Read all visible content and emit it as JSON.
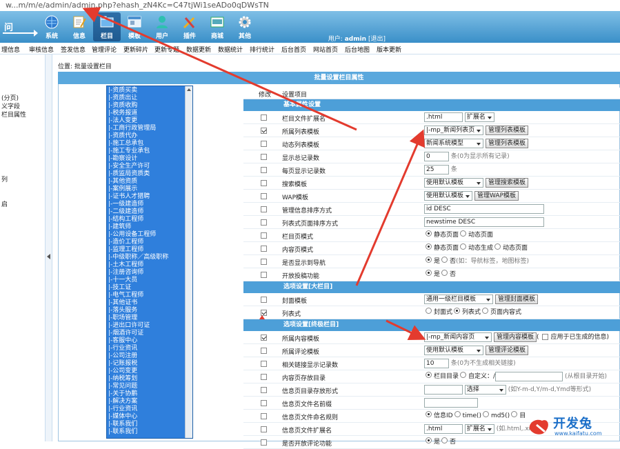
{
  "url": "w...m/m/e/admin/admin.php?ehash_zN4Kc=C47tjWi1seADo0qDWsTN",
  "header": {
    "logo": "问",
    "nav": [
      {
        "label": "系统",
        "icon": "globe-icon"
      },
      {
        "label": "信息",
        "icon": "edit-icon"
      },
      {
        "label": "栏目",
        "icon": "folder-icon",
        "active": true
      },
      {
        "label": "模板",
        "icon": "window-icon"
      },
      {
        "label": "用户",
        "icon": "user-icon"
      },
      {
        "label": "插件",
        "icon": "tools-icon"
      },
      {
        "label": "商城",
        "icon": "shop-icon"
      },
      {
        "label": "其他",
        "icon": "gear-icon"
      }
    ],
    "user_label": "用户:",
    "user_name": "admin",
    "logout": "[退出]"
  },
  "menubar": [
    "理信息",
    "审核信息",
    "签发信息",
    "管理评论",
    "更新碎片",
    "更新专题",
    "数据更新",
    "数据统计",
    "排行统计",
    "后台首页",
    "网站首页",
    "后台地图",
    "版本更新"
  ],
  "sidebar": [
    "(分页)",
    "义字段",
    "栏目属性",
    "列",
    "启"
  ],
  "breadcrumb": {
    "prefix": "位置:",
    "link": "批量设置栏目"
  },
  "panel_title": "批量设置栏目属性",
  "tree": [
    "|-资质买卖",
    "|-资质出让",
    "|-资质收购",
    "|-税务报道",
    "|-法人变更",
    "|-工商行政管理局",
    "|-资质代办",
    "|-施工总承包",
    "|-施工专业承包",
    "|-勘察设计",
    "|-安全生产许可",
    "|-质监局资质类",
    "|-其他资质",
    "|-案例展示",
    "|-证书人才猎聘",
    "|-一级建造师",
    "|-二级建造师",
    "|-结构工程师",
    "|-建筑师",
    "|-公用设备工程师",
    "|-造价工程师",
    "|-监理工程师",
    "|-中级职称／高级职称",
    "|-土木工程师",
    "|-注册咨询师",
    "|-十一大员",
    "|-技工证",
    "|-电气工程师",
    "|-其他证书",
    "|-落头服务",
    "|-职场管理",
    "|-进出口许可证",
    "|-烟酒许可证",
    "|-客服中心",
    "|-行业资讯",
    "|-公司注册",
    "|-记账报税",
    "|-公司变更",
    "|-纳税筹划",
    "|-常见问题",
    "|-关于协鹏",
    "|-解决方案",
    "|-行业资讯",
    "|-媒体中心",
    "|-联系我们",
    "|-联系我们"
  ],
  "table_head": {
    "modify": "修改",
    "item": "设置项目"
  },
  "sections": {
    "basic": "基本属性设置",
    "major": "选项设置[大栏目]",
    "final": "选项设置[终极栏目]"
  },
  "rows": {
    "r1": {
      "label": "栏目文件扩展名",
      "value": ".html",
      "select": "扩展名",
      "checked": false
    },
    "r2": {
      "label": "所属列表模板",
      "select": "|-mp_新闻列表页",
      "button": "管理列表模板",
      "checked": true
    },
    "r3": {
      "label": "动态列表模板",
      "select": "新闻系统模型",
      "button": "管理列表模板",
      "checked": false
    },
    "r4": {
      "label": "显示总记录数",
      "value": "0",
      "hint": "条(0为显示所有记录)",
      "checked": false
    },
    "r5": {
      "label": "每页显示记录数",
      "value": "25",
      "hint": "条",
      "checked": false
    },
    "r6": {
      "label": "搜索模板",
      "select": "使用默认模板",
      "button": "管理搜索模板",
      "checked": false
    },
    "r7": {
      "label": "WAP模板",
      "select": "使用默认模板",
      "button": "管理WAP模板",
      "checked": false
    },
    "r8": {
      "label": "管理信息排序方式",
      "value": "id DESC",
      "checked": false
    },
    "r9": {
      "label": "列表式页面排序方式",
      "value": "newstime DESC",
      "checked": false
    },
    "r10": {
      "label": "栏目页模式",
      "opt1": "静态页面",
      "opt2": "动态页面",
      "checked": false
    },
    "r11": {
      "label": "内容页模式",
      "opt1": "静态页面",
      "opt2": "动态生成",
      "opt3": "动态页面",
      "checked": false
    },
    "r12": {
      "label": "是否显示到导航",
      "opt1": "是",
      "opt2": "否",
      "hint": "(如：导航标签，地图标签)",
      "checked": false
    },
    "r13": {
      "label": "开放投稿功能",
      "opt1": "是",
      "opt2": "否",
      "checked": false
    },
    "r14": {
      "label": "封面模板",
      "select": "通用一级栏目模板",
      "button": "管理封面模板",
      "checked": false
    },
    "r15": {
      "label": "列表式",
      "opt1": "封面式",
      "opt2": "列表式",
      "opt3": "页面内容式",
      "checked": true
    },
    "r16": {
      "label": "所属内容模板",
      "select": "|-mp_新闻内容页",
      "button": "管理内容模板",
      "extra": "应用于已生成的信息)",
      "checked": true
    },
    "r17": {
      "label": "所属评论模板",
      "select": "使用默认模板",
      "button": "管理评论模板",
      "checked": false
    },
    "r18": {
      "label": "相关链接显示记录数",
      "value": "10",
      "hint": "条(0为不生成相关链接)",
      "checked": false
    },
    "r19": {
      "label": "内容页存放目录",
      "opt1": "栏目目录",
      "opt2": "自定义：",
      "hint": "(从根目录开始)",
      "checked": false
    },
    "r20": {
      "label": "信息页目录存放形式",
      "select": "选择",
      "hint": "(如Y-m-d,Y/m-d,Ymd等形式)",
      "checked": false
    },
    "r21": {
      "label": "信息页文件名前缀",
      "checked": false
    },
    "r22": {
      "label": "信息页文件命名规则",
      "opt1": "信息ID",
      "opt2": "time()",
      "opt3": "md5()",
      "opt4": "目",
      "checked": false
    },
    "r23": {
      "label": "信息页文件扩展名",
      "value": ".html",
      "select": "扩展名",
      "hint": "(如.html,.xml",
      "checked": false
    },
    "r24": {
      "label": "是否开放评论功能",
      "opt1": "是",
      "opt2": "否",
      "checked": false
    }
  },
  "watermark": {
    "title": "开发兔",
    "url": "www.kaifatu.com"
  },
  "colors": {
    "header": "#3a8fc8",
    "tree": "#2f7fdc",
    "section": "#4d9fd8",
    "arrow": "#e33b2e"
  }
}
